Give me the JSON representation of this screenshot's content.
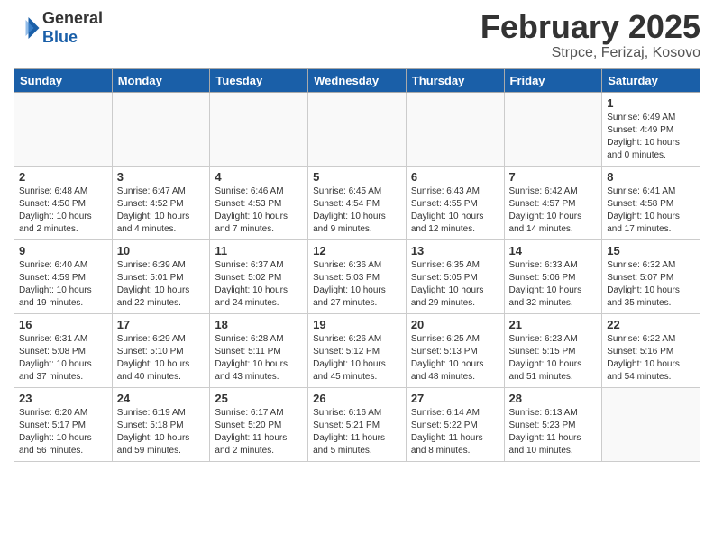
{
  "header": {
    "logo_general": "General",
    "logo_blue": "Blue",
    "month_title": "February 2025",
    "location": "Strpce, Ferizaj, Kosovo"
  },
  "weekdays": [
    "Sunday",
    "Monday",
    "Tuesday",
    "Wednesday",
    "Thursday",
    "Friday",
    "Saturday"
  ],
  "weeks": [
    [
      {
        "day": "",
        "info": ""
      },
      {
        "day": "",
        "info": ""
      },
      {
        "day": "",
        "info": ""
      },
      {
        "day": "",
        "info": ""
      },
      {
        "day": "",
        "info": ""
      },
      {
        "day": "",
        "info": ""
      },
      {
        "day": "1",
        "info": "Sunrise: 6:49 AM\nSunset: 4:49 PM\nDaylight: 10 hours and 0 minutes."
      }
    ],
    [
      {
        "day": "2",
        "info": "Sunrise: 6:48 AM\nSunset: 4:50 PM\nDaylight: 10 hours and 2 minutes."
      },
      {
        "day": "3",
        "info": "Sunrise: 6:47 AM\nSunset: 4:52 PM\nDaylight: 10 hours and 4 minutes."
      },
      {
        "day": "4",
        "info": "Sunrise: 6:46 AM\nSunset: 4:53 PM\nDaylight: 10 hours and 7 minutes."
      },
      {
        "day": "5",
        "info": "Sunrise: 6:45 AM\nSunset: 4:54 PM\nDaylight: 10 hours and 9 minutes."
      },
      {
        "day": "6",
        "info": "Sunrise: 6:43 AM\nSunset: 4:55 PM\nDaylight: 10 hours and 12 minutes."
      },
      {
        "day": "7",
        "info": "Sunrise: 6:42 AM\nSunset: 4:57 PM\nDaylight: 10 hours and 14 minutes."
      },
      {
        "day": "8",
        "info": "Sunrise: 6:41 AM\nSunset: 4:58 PM\nDaylight: 10 hours and 17 minutes."
      }
    ],
    [
      {
        "day": "9",
        "info": "Sunrise: 6:40 AM\nSunset: 4:59 PM\nDaylight: 10 hours and 19 minutes."
      },
      {
        "day": "10",
        "info": "Sunrise: 6:39 AM\nSunset: 5:01 PM\nDaylight: 10 hours and 22 minutes."
      },
      {
        "day": "11",
        "info": "Sunrise: 6:37 AM\nSunset: 5:02 PM\nDaylight: 10 hours and 24 minutes."
      },
      {
        "day": "12",
        "info": "Sunrise: 6:36 AM\nSunset: 5:03 PM\nDaylight: 10 hours and 27 minutes."
      },
      {
        "day": "13",
        "info": "Sunrise: 6:35 AM\nSunset: 5:05 PM\nDaylight: 10 hours and 29 minutes."
      },
      {
        "day": "14",
        "info": "Sunrise: 6:33 AM\nSunset: 5:06 PM\nDaylight: 10 hours and 32 minutes."
      },
      {
        "day": "15",
        "info": "Sunrise: 6:32 AM\nSunset: 5:07 PM\nDaylight: 10 hours and 35 minutes."
      }
    ],
    [
      {
        "day": "16",
        "info": "Sunrise: 6:31 AM\nSunset: 5:08 PM\nDaylight: 10 hours and 37 minutes."
      },
      {
        "day": "17",
        "info": "Sunrise: 6:29 AM\nSunset: 5:10 PM\nDaylight: 10 hours and 40 minutes."
      },
      {
        "day": "18",
        "info": "Sunrise: 6:28 AM\nSunset: 5:11 PM\nDaylight: 10 hours and 43 minutes."
      },
      {
        "day": "19",
        "info": "Sunrise: 6:26 AM\nSunset: 5:12 PM\nDaylight: 10 hours and 45 minutes."
      },
      {
        "day": "20",
        "info": "Sunrise: 6:25 AM\nSunset: 5:13 PM\nDaylight: 10 hours and 48 minutes."
      },
      {
        "day": "21",
        "info": "Sunrise: 6:23 AM\nSunset: 5:15 PM\nDaylight: 10 hours and 51 minutes."
      },
      {
        "day": "22",
        "info": "Sunrise: 6:22 AM\nSunset: 5:16 PM\nDaylight: 10 hours and 54 minutes."
      }
    ],
    [
      {
        "day": "23",
        "info": "Sunrise: 6:20 AM\nSunset: 5:17 PM\nDaylight: 10 hours and 56 minutes."
      },
      {
        "day": "24",
        "info": "Sunrise: 6:19 AM\nSunset: 5:18 PM\nDaylight: 10 hours and 59 minutes."
      },
      {
        "day": "25",
        "info": "Sunrise: 6:17 AM\nSunset: 5:20 PM\nDaylight: 11 hours and 2 minutes."
      },
      {
        "day": "26",
        "info": "Sunrise: 6:16 AM\nSunset: 5:21 PM\nDaylight: 11 hours and 5 minutes."
      },
      {
        "day": "27",
        "info": "Sunrise: 6:14 AM\nSunset: 5:22 PM\nDaylight: 11 hours and 8 minutes."
      },
      {
        "day": "28",
        "info": "Sunrise: 6:13 AM\nSunset: 5:23 PM\nDaylight: 11 hours and 10 minutes."
      },
      {
        "day": "",
        "info": ""
      }
    ]
  ]
}
